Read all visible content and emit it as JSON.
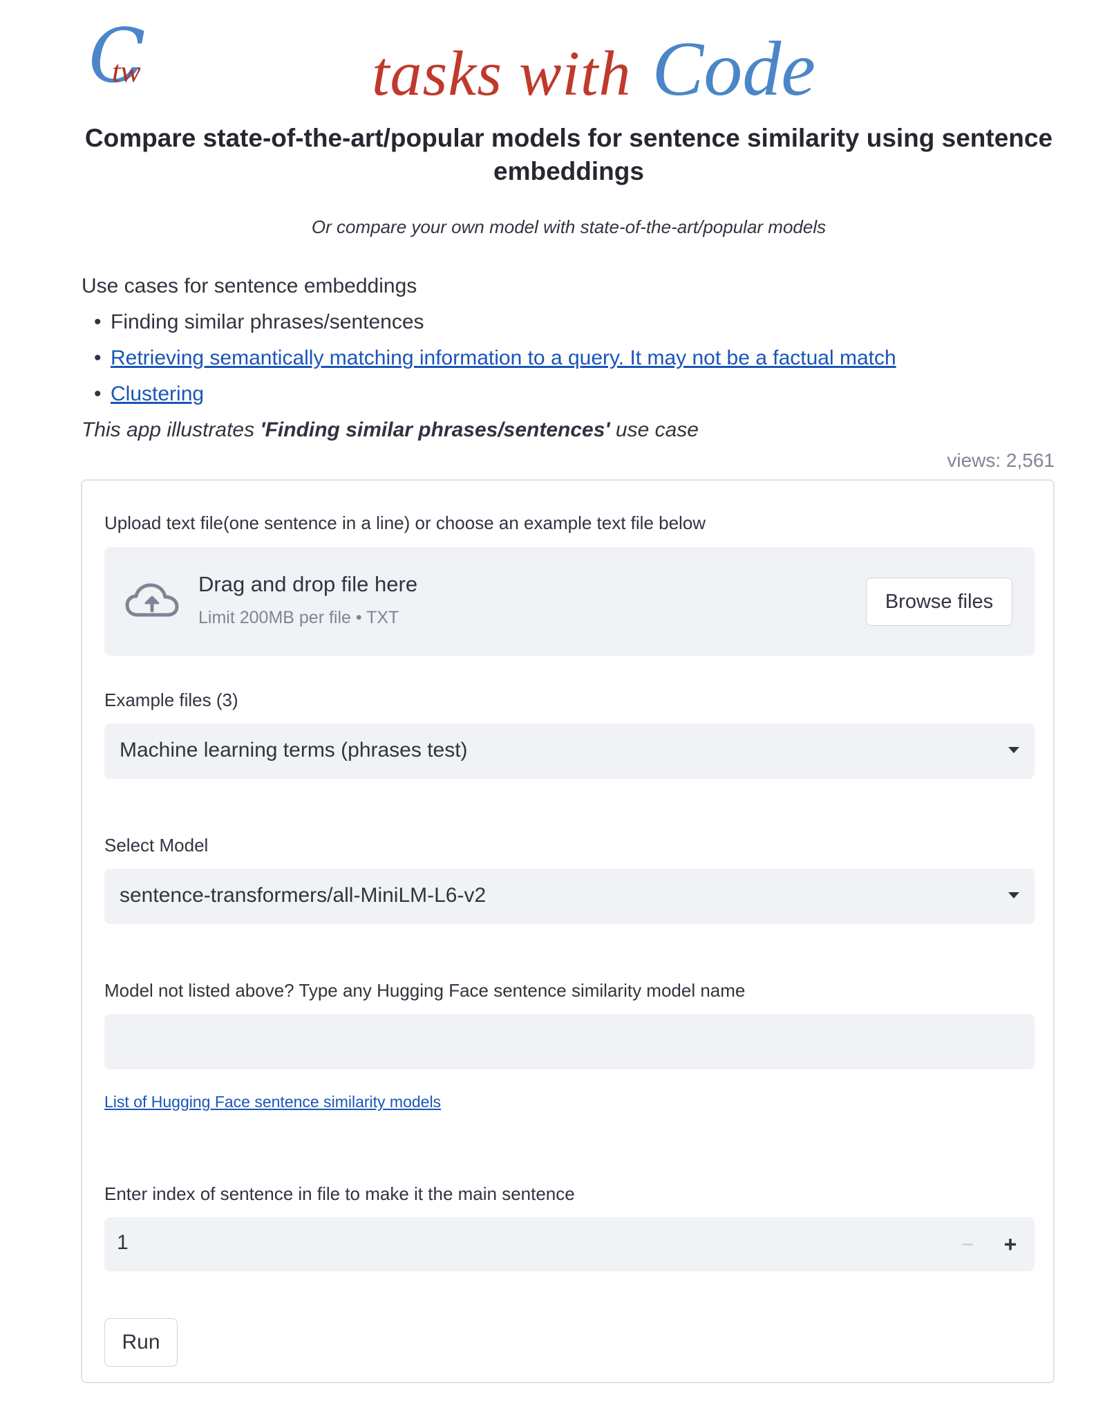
{
  "header": {
    "logo": {
      "letter_c": "C",
      "letters_tw": "tw",
      "colors": {
        "blue": "#4a86c8",
        "red": "#c0392b"
      }
    },
    "brand_red": "tasks with",
    "brand_blue": "Code"
  },
  "title": "Compare state-of-the-art/popular models for sentence similarity using sentence embeddings",
  "subtitle": "Or compare your own model with state-of-the-art/popular models",
  "use_cases": {
    "heading": "Use cases for sentence embeddings",
    "items": [
      {
        "label": "Finding similar phrases/sentences",
        "is_link": false
      },
      {
        "label": "Retrieving semantically matching information to a query. It may not be a factual match",
        "is_link": true
      },
      {
        "label": "Clustering",
        "is_link": true
      }
    ],
    "illustrates_prefix": "This app illustrates ",
    "illustrates_bold": "'Finding similar phrases/sentences'",
    "illustrates_suffix": " use case"
  },
  "views": "views: 2,561",
  "form": {
    "upload_label": "Upload text file(one sentence in a line) or choose an example text file below",
    "uploader": {
      "icon": "cloud-upload-icon",
      "title": "Drag and drop file here",
      "limit": "Limit 200MB per file • TXT",
      "browse_label": "Browse files"
    },
    "example_files": {
      "label": "Example files (3)",
      "selected": "Machine learning terms (phrases test)"
    },
    "model_select": {
      "label": "Select Model",
      "selected": "sentence-transformers/all-MiniLM-L6-v2"
    },
    "custom_model": {
      "label": "Model not listed above? Type any Hugging Face sentence similarity model name",
      "value": "",
      "placeholder": ""
    },
    "hf_models_link": "List of Hugging Face sentence similarity models",
    "index": {
      "label": "Enter index of sentence in file to make it the main sentence",
      "value": "1",
      "minus": "−",
      "plus": "+"
    },
    "run_label": "Run"
  },
  "colors": {
    "link": "#1a55b8",
    "input_bg": "#f0f2f6",
    "border": "#e1e3e8",
    "muted": "#808495"
  }
}
